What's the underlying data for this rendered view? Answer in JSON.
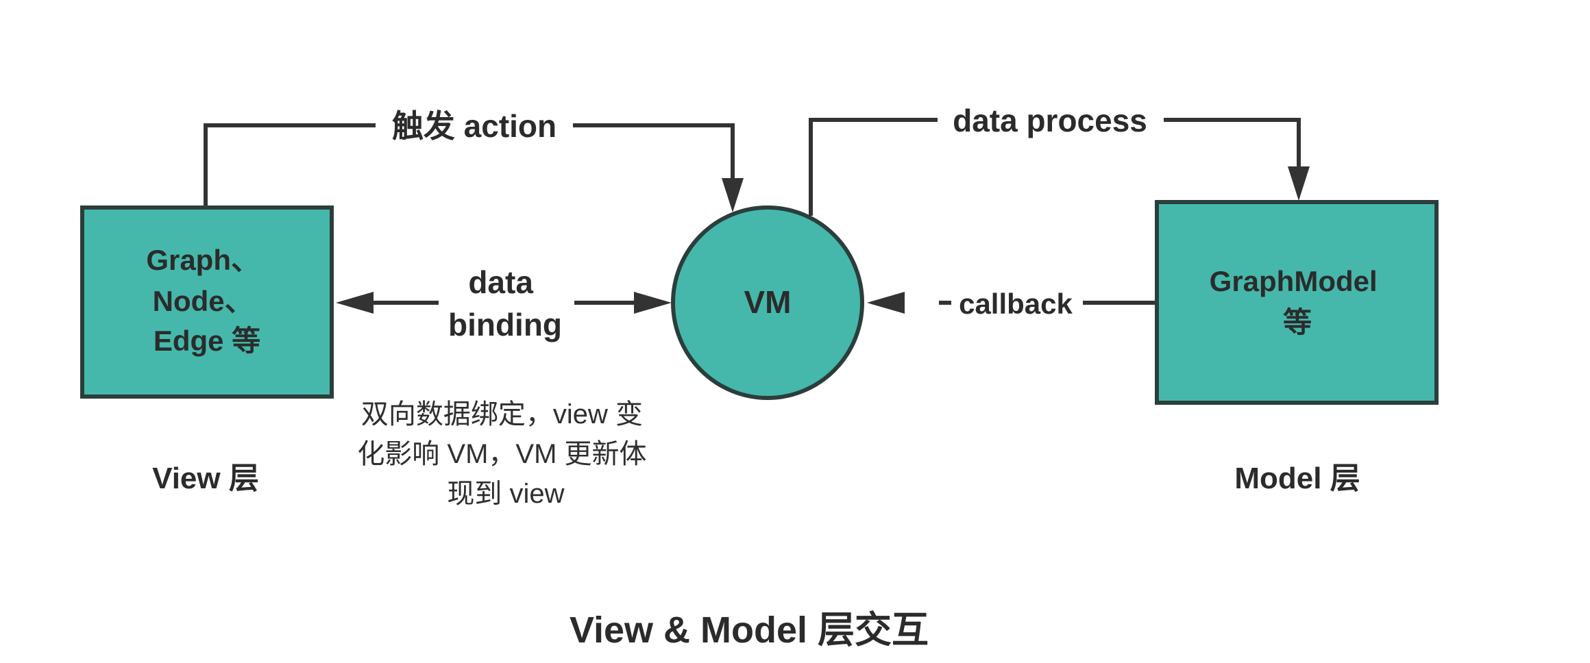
{
  "view_box": {
    "lines": [
      "Graph、",
      "Node、",
      "Edge 等"
    ]
  },
  "vm_circle": {
    "label": "VM"
  },
  "model_box": {
    "lines": [
      "GraphModel",
      "等"
    ]
  },
  "edges": {
    "trigger_action": "触发 action",
    "data_process": "data process",
    "data_binding_lines": [
      "data",
      "binding"
    ],
    "callback": "callback"
  },
  "annotation_lines": [
    "双向数据绑定，view 变",
    "化影响 VM，VM 更新体",
    "现到 view"
  ],
  "layer_labels": {
    "view": "View 层",
    "model": "Model 层"
  },
  "caption": "View & Model 层交互",
  "colors": {
    "node_fill": "#45b8ab",
    "node_border": "#2b3e3b",
    "edge": "#333333"
  }
}
